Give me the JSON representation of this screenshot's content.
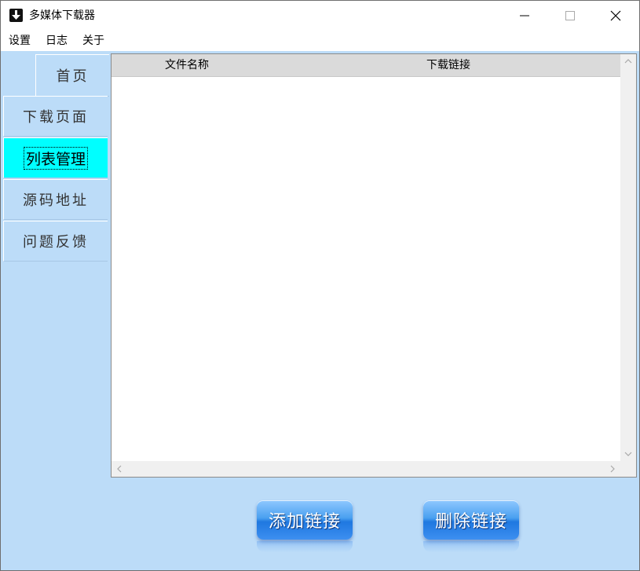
{
  "window": {
    "title": "多媒体下载器",
    "app_icon": "download-arrow-icon",
    "controls": [
      "minimize-icon",
      "maximize-icon",
      "close-icon"
    ]
  },
  "menu": {
    "items": [
      {
        "label": "设置"
      },
      {
        "label": "日志"
      },
      {
        "label": "关于"
      }
    ]
  },
  "sidebar": {
    "tabs": [
      {
        "label": "首页"
      },
      {
        "label": "下载页面"
      },
      {
        "label": "列表管理",
        "selected": true
      },
      {
        "label": "源码地址"
      },
      {
        "label": "问题反馈"
      }
    ],
    "selected_color": "#00ffff"
  },
  "list": {
    "columns": [
      "文件名称",
      "下载链接"
    ],
    "rows": []
  },
  "buttons": {
    "add_label": "添加链接",
    "delete_label": "删除链接"
  },
  "colors": {
    "client_background": "#bcdcf8",
    "header_background": "#dadada",
    "button_blue": "#1f78e0"
  }
}
